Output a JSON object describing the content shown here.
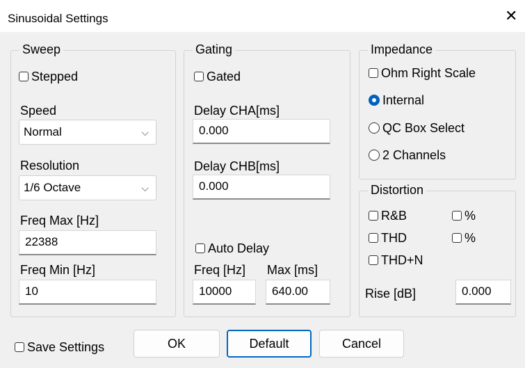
{
  "window": {
    "title": "Sinusoidal Settings",
    "close_glyph": "✕"
  },
  "sweep": {
    "legend": "Sweep",
    "stepped_label": "Stepped",
    "speed_label": "Speed",
    "speed_value": "Normal",
    "resolution_label": "Resolution",
    "resolution_value": "1/6 Octave",
    "freq_max_label": "Freq Max [Hz]",
    "freq_max_value": "22388",
    "freq_min_label": "Freq Min [Hz]",
    "freq_min_value": "10"
  },
  "gating": {
    "legend": "Gating",
    "gated_label": "Gated",
    "delay_cha_label": "Delay CHA[ms]",
    "delay_cha_value": "0.000",
    "delay_chb_label": "Delay CHB[ms]",
    "delay_chb_value": "0.000",
    "auto_delay_label": "Auto Delay",
    "freq_label": "Freq [Hz]",
    "freq_value": "10000",
    "max_label": "Max [ms]",
    "max_value": "640.00"
  },
  "impedance": {
    "legend": "Impedance",
    "ohm_right_scale_label": "Ohm Right Scale",
    "options": [
      "Internal",
      "QC Box Select",
      "2 Channels"
    ],
    "selected": "Internal"
  },
  "distortion": {
    "legend": "Distortion",
    "rb_label": "R&B",
    "rb_pct_label": "%",
    "thd_label": "THD",
    "thd_pct_label": "%",
    "thdn_label": "THD+N",
    "rise_label": "Rise [dB]",
    "rise_value": "0.000"
  },
  "footer": {
    "save_settings_label": "Save Settings",
    "ok_label": "OK",
    "default_label": "Default",
    "cancel_label": "Cancel"
  },
  "colors": {
    "accent": "#0067c0",
    "background": "#f0f0f0"
  }
}
